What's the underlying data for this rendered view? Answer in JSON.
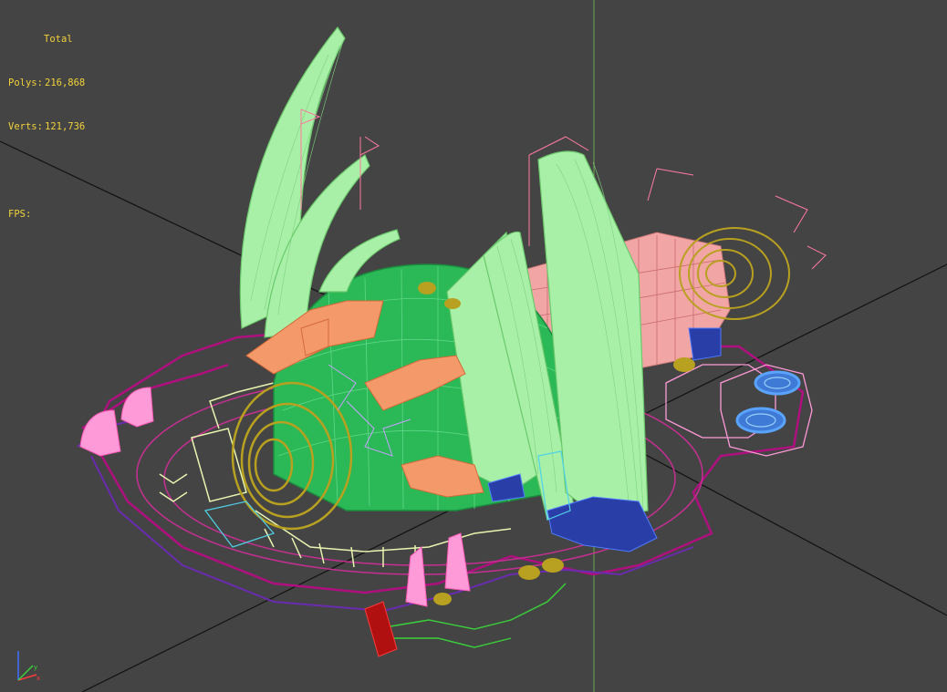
{
  "stats": {
    "title": "Total",
    "polys_label": "Polys:",
    "polys_value": "216,868",
    "verts_label": "Verts:",
    "verts_value": "121,736",
    "fps_label": "FPS:",
    "fps_value": ""
  },
  "colors": {
    "background": "#444444",
    "grid": "#111111",
    "axis_line": "#6aa84f",
    "stats_text": "#f2d23a",
    "tusk": "#a8f0a8",
    "body": "#2bb856",
    "barrel": "#f2a5a5",
    "gold": "#b8a020",
    "orange": "#f49a6a",
    "base_purple": "#b0107f",
    "base_violet": "#6a2bb0",
    "blue": "#5aa4ff",
    "pink": "#ff9ad8"
  },
  "gizmo": {
    "icon": "axis-gizmo-icon"
  }
}
